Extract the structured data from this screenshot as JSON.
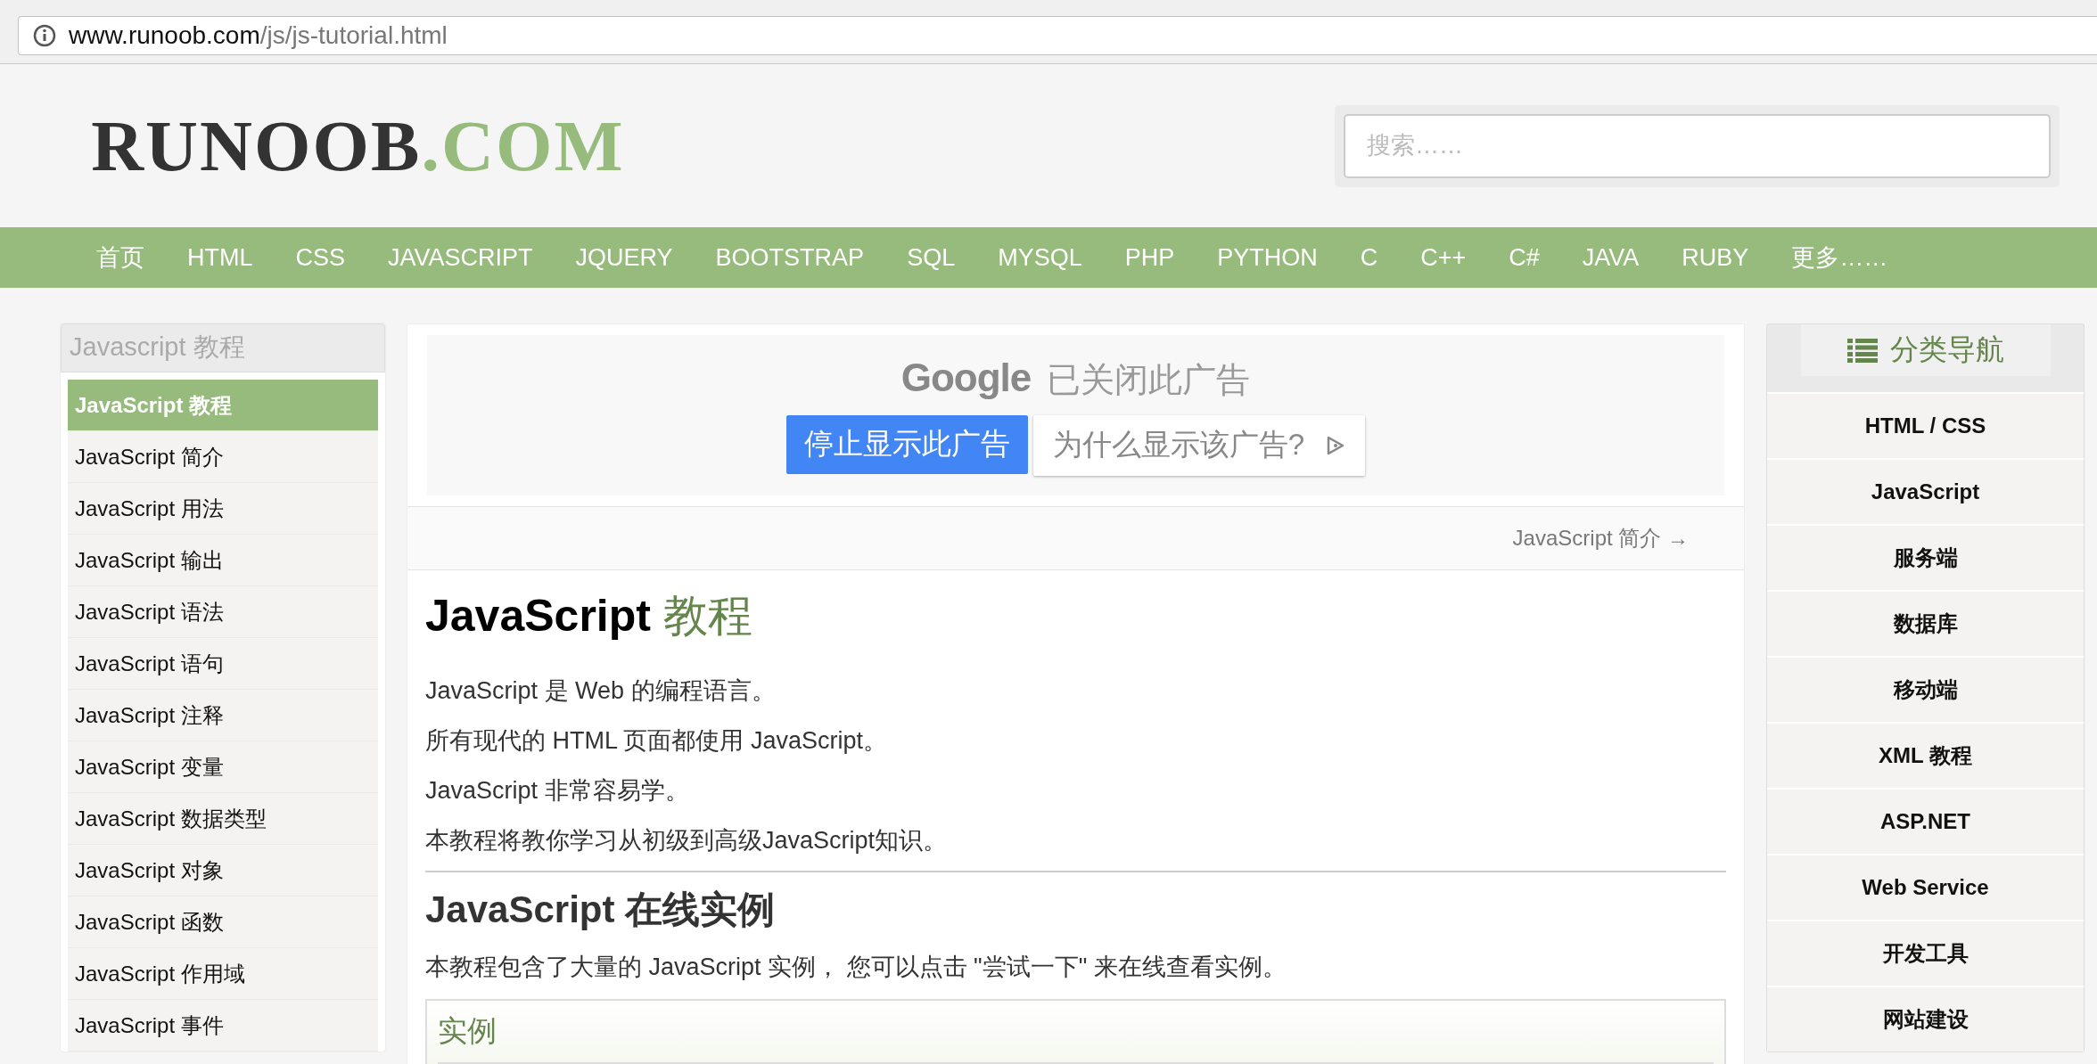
{
  "address_bar": {
    "url_host": "www.runoob.com",
    "url_path": "/js/js-tutorial.html"
  },
  "header": {
    "logo": {
      "main": "RUNOOB",
      "suffix": ".COM"
    },
    "search": {
      "placeholder": "搜索……"
    }
  },
  "nav": {
    "items": [
      {
        "label": "首页"
      },
      {
        "label": "HTML"
      },
      {
        "label": "CSS"
      },
      {
        "label": "JAVASCRIPT"
      },
      {
        "label": "JQUERY"
      },
      {
        "label": "BOOTSTRAP"
      },
      {
        "label": "SQL"
      },
      {
        "label": "MYSQL"
      },
      {
        "label": "PHP"
      },
      {
        "label": "PYTHON"
      },
      {
        "label": "C"
      },
      {
        "label": "C++"
      },
      {
        "label": "C#"
      },
      {
        "label": "JAVA"
      },
      {
        "label": "RUBY"
      },
      {
        "label": "更多……"
      }
    ]
  },
  "sidebar": {
    "title": "Javascript 教程",
    "items": [
      {
        "label": "JavaScript 教程",
        "selected": true
      },
      {
        "label": "JavaScript 简介",
        "selected": false
      },
      {
        "label": "JavaScript 用法",
        "selected": false
      },
      {
        "label": "JavaScript 输出",
        "selected": false
      },
      {
        "label": "JavaScript 语法",
        "selected": false
      },
      {
        "label": "JavaScript 语句",
        "selected": false
      },
      {
        "label": "JavaScript 注释",
        "selected": false
      },
      {
        "label": "JavaScript 变量",
        "selected": false
      },
      {
        "label": "JavaScript 数据类型",
        "selected": false
      },
      {
        "label": "JavaScript 对象",
        "selected": false
      },
      {
        "label": "JavaScript 函数",
        "selected": false
      },
      {
        "label": "JavaScript 作用域",
        "selected": false
      },
      {
        "label": "JavaScript 事件",
        "selected": false
      }
    ]
  },
  "ad": {
    "brand": "Google",
    "message": "已关闭此广告",
    "stop_button": "停止显示此广告",
    "why_button": "为什么显示该广告?"
  },
  "article": {
    "next_link": "JavaScript 简介 →",
    "title": {
      "main": "JavaScript",
      "accent": "教程"
    },
    "paragraphs": [
      "JavaScript 是 Web 的编程语言。",
      "所有现代的 HTML 页面都使用 JavaScript。",
      "JavaScript 非常容易学。",
      "本教程将教你学习从初级到高级JavaScript知识。"
    ],
    "section_title": "JavaScript 在线实例",
    "section_text": "本教程包含了大量的 JavaScript 实例， 您可以点击 \"尝试一下\" 来在线查看实例。",
    "example_title": "实例"
  },
  "category_nav": {
    "title": "分类导航",
    "items": [
      {
        "label": "HTML / CSS"
      },
      {
        "label": "JavaScript"
      },
      {
        "label": "服务端"
      },
      {
        "label": "数据库"
      },
      {
        "label": "移动端"
      },
      {
        "label": "XML 教程"
      },
      {
        "label": "ASP.NET"
      },
      {
        "label": "Web Service"
      },
      {
        "label": "开发工具"
      },
      {
        "label": "网站建设"
      }
    ]
  }
}
